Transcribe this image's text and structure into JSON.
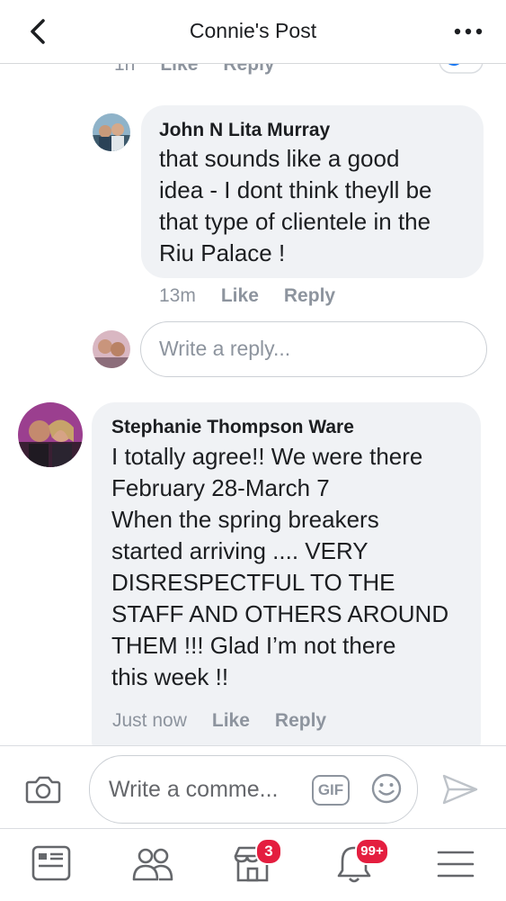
{
  "header": {
    "title": "Connie's Post"
  },
  "prev_comment": {
    "time": "1h",
    "like": "Like",
    "reply": "Reply"
  },
  "reply_comment": {
    "author": "John N Lita Murray",
    "text": "that sounds like a good\nidea - I dont think theyll be\nthat type of clientele in the\nRiu Palace !",
    "time": "13m",
    "like": "Like",
    "reply": "Reply"
  },
  "reply_input": {
    "placeholder": "Write a reply..."
  },
  "comment": {
    "author": "Stephanie Thompson Ware",
    "text": "I totally agree!! We were there\nFebruary 28-March 7\nWhen the spring breakers\nstarted arriving .... VERY\nDISRESPECTFUL TO THE\nSTAFF AND OTHERS AROUND\nTHEM !!! Glad I’m not there\nthis week !!",
    "time": "Just now",
    "like": "Like",
    "reply": "Reply"
  },
  "composer": {
    "placeholder": "Write a comme...",
    "gif_label": "GIF"
  },
  "tabbar": {
    "items": [
      {
        "icon": "news-feed-icon"
      },
      {
        "icon": "friends-icon"
      },
      {
        "icon": "marketplace-icon",
        "badge": "3"
      },
      {
        "icon": "notifications-icon",
        "badge": "99+"
      },
      {
        "icon": "menu-icon"
      }
    ]
  },
  "colors": {
    "accent": "#1877f2",
    "badge": "#e41e3f",
    "bubble": "#f0f2f5",
    "meta": "#8d949e"
  }
}
